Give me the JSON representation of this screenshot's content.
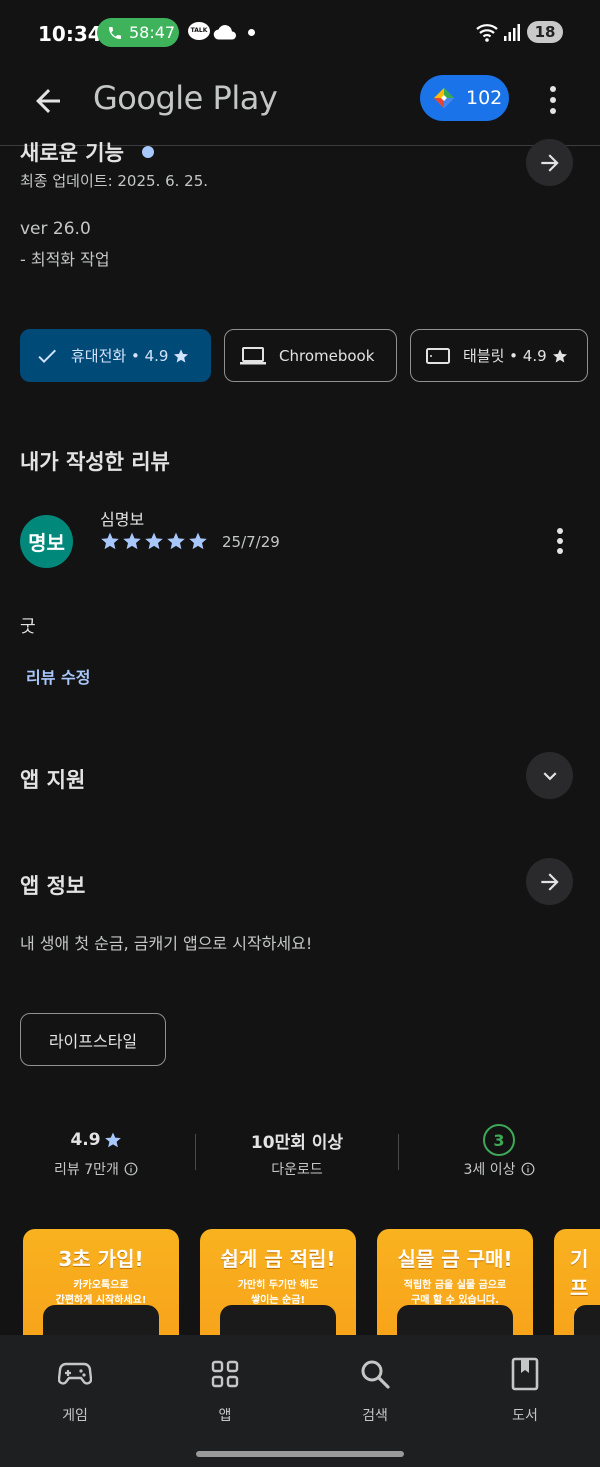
{
  "status_bar": {
    "time": "10:34",
    "call_timer": "58:47",
    "talk_label": "TALK",
    "battery": "18"
  },
  "app_bar": {
    "title": "Google Play",
    "points": "102"
  },
  "whats_new": {
    "title": "새로운 기능",
    "last_updated": "최종 업데이트: 2025. 6. 25.",
    "version": "ver 26.0",
    "note": "- 최적화 작업"
  },
  "device_chips": [
    {
      "label": "휴대전화 • 4.9",
      "selected": true
    },
    {
      "label": "Chromebook",
      "selected": false
    },
    {
      "label": "태블릿 • 4.9",
      "selected": false
    }
  ],
  "my_review": {
    "section_title": "내가 작성한 리뷰",
    "avatar_text": "명보",
    "reviewer_name": "심명보",
    "rating": 5,
    "date": "25/7/29",
    "text": "굿",
    "edit_label": "리뷰 수정"
  },
  "app_support": {
    "title": "앱 지원"
  },
  "app_info": {
    "title": "앱 정보",
    "description": "내 생애 첫 순금, 금캐기 앱으로 시작하세요!",
    "category_chip": "라이프스타일"
  },
  "stats": {
    "rating": "4.9",
    "rating_label": "리뷰 7만개",
    "downloads": "10만회 이상",
    "downloads_label": "다운로드",
    "age_rating": "3",
    "age_label": "3세 이상"
  },
  "screenshots": [
    {
      "title": "3초 가입!",
      "subtitle_1": "카카오톡으로",
      "subtitle_2": "간편하게 시작하세요!"
    },
    {
      "title": "쉽게 금 적립!",
      "subtitle_1": "가만히 두기만 해도",
      "subtitle_2": "쌓이는 순금!"
    },
    {
      "title": "실물 금 구매!",
      "subtitle_1": "적립한 금을 실물 금으로",
      "subtitle_2": "구매 할 수 있습니다."
    },
    {
      "title": "기프",
      "subtitle_1": "기프",
      "subtitle_2": ""
    }
  ],
  "bottom_nav": {
    "games": "게임",
    "apps": "앱",
    "search": "검색",
    "books": "도서"
  },
  "colors": {
    "background": "#131314",
    "accent_blue": "#1a73e8",
    "selected_chip": "#004a77",
    "link_blue": "#a8c7fa",
    "avatar_teal": "#00897b",
    "call_green": "#3fb35c",
    "screenshot_orange": "#f9b21f"
  }
}
